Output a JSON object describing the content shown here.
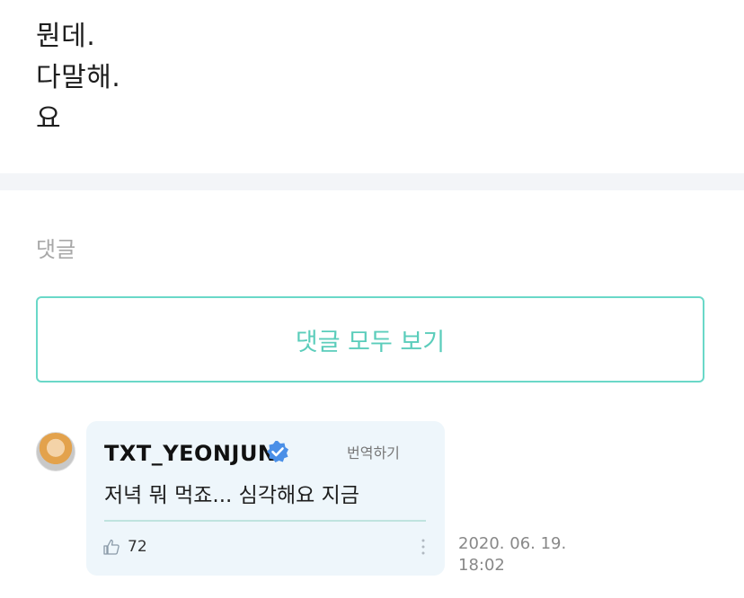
{
  "post": {
    "lines": [
      "뭔데.",
      "다말해.",
      "요"
    ]
  },
  "comments_section": {
    "title": "댓글",
    "view_all_label": "댓글 모두 보기"
  },
  "comment": {
    "author": "TXT_YEONJUN",
    "translate_label": "번역하기",
    "text": "저녁 뭐 먹죠... 심각해요 지금",
    "likes": "72",
    "date": "2020. 06. 19.",
    "time": "18:02"
  },
  "icons": {
    "verified": "verified-badge-icon",
    "like": "thumbs-up-icon",
    "more": "more-vertical-icon"
  },
  "colors": {
    "accent": "#5bcdbb",
    "bubble": "#eef6fb",
    "verified": "#4a8fe7"
  }
}
